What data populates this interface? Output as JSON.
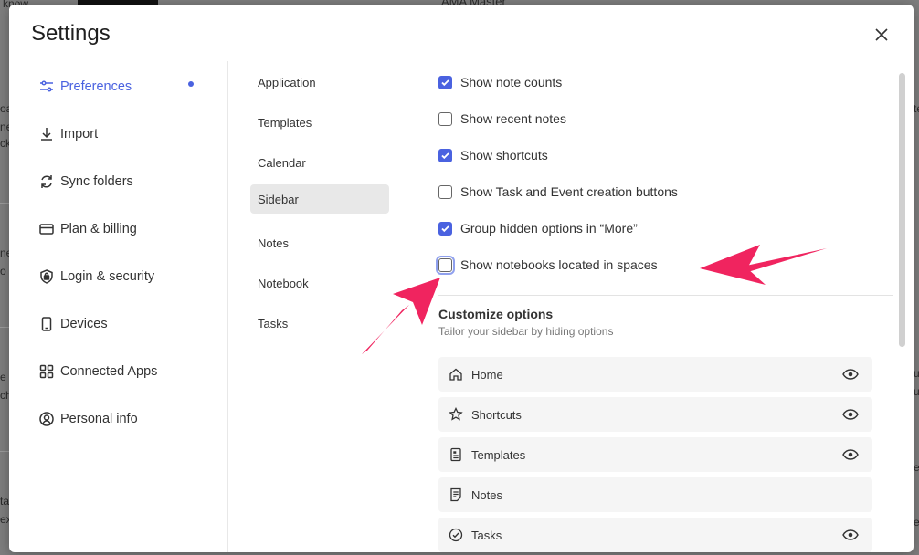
{
  "background": {
    "fragments": [
      "know",
      "AMA Master",
      "oa",
      "ne",
      "ck",
      "ne",
      "o i",
      "e",
      "ch",
      "ta",
      "ex",
      "te",
      "u",
      "u",
      "e",
      "e"
    ]
  },
  "modal": {
    "title": "Settings",
    "close_label": "×"
  },
  "nav": {
    "items": [
      {
        "label": "Preferences",
        "icon": "sliders-icon"
      },
      {
        "label": "Import",
        "icon": "download-icon"
      },
      {
        "label": "Sync folders",
        "icon": "sync-icon"
      },
      {
        "label": "Plan & billing",
        "icon": "credit-card-icon"
      },
      {
        "label": "Login & security",
        "icon": "shield-lock-icon"
      },
      {
        "label": "Devices",
        "icon": "device-icon"
      },
      {
        "label": "Connected Apps",
        "icon": "apps-grid-icon"
      },
      {
        "label": "Personal info",
        "icon": "user-circle-icon"
      }
    ],
    "active": "Preferences"
  },
  "subnav": {
    "items": [
      "Application",
      "Templates",
      "Calendar",
      "Sidebar",
      "Notes",
      "Notebook",
      "Tasks"
    ],
    "active": "Sidebar"
  },
  "options": [
    {
      "label": "Show note counts",
      "checked": true
    },
    {
      "label": "Show recent notes",
      "checked": false
    },
    {
      "label": "Show shortcuts",
      "checked": true
    },
    {
      "label": "Show Task and Event creation buttons",
      "checked": false
    },
    {
      "label": "Group hidden options in “More”",
      "checked": true
    },
    {
      "label": "Show notebooks located in spaces",
      "checked": false
    }
  ],
  "customize": {
    "title": "Customize options",
    "description": "Tailor your sidebar by hiding options",
    "items": [
      {
        "label": "Home",
        "icon": "home-icon",
        "visible_toggle": true
      },
      {
        "label": "Shortcuts",
        "icon": "star-icon",
        "visible_toggle": true
      },
      {
        "label": "Templates",
        "icon": "template-icon",
        "visible_toggle": true
      },
      {
        "label": "Notes",
        "icon": "note-icon",
        "visible_toggle": false
      },
      {
        "label": "Tasks",
        "icon": "check-circle-icon",
        "visible_toggle": true
      }
    ]
  },
  "colors": {
    "accent": "#4a62e0",
    "annotation_arrow": "#f0245f"
  }
}
